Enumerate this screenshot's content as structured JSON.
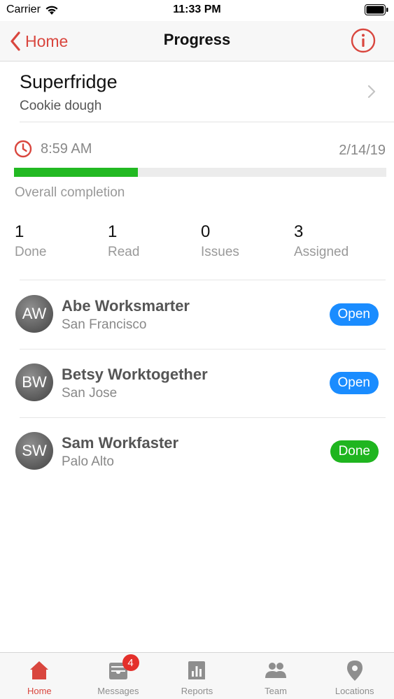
{
  "status_bar": {
    "carrier": "Carrier",
    "time": "11:33 PM"
  },
  "nav": {
    "back_label": "Home",
    "title": "Progress"
  },
  "product": {
    "name": "Superfridge",
    "subtitle": "Cookie dough"
  },
  "progress": {
    "time": "8:59 AM",
    "date": "2/14/19",
    "completion_label": "Overall completion",
    "completion_fraction": 0.333
  },
  "stats": [
    {
      "value": "1",
      "label": "Done"
    },
    {
      "value": "1",
      "label": "Read"
    },
    {
      "value": "0",
      "label": "Issues"
    },
    {
      "value": "3",
      "label": "Assigned"
    }
  ],
  "people": [
    {
      "initials": "AW",
      "name": "Abe Worksmarter",
      "location": "San Francisco",
      "status": "Open",
      "status_color": "#1a8cff"
    },
    {
      "initials": "BW",
      "name": "Betsy Worktogether",
      "location": "San Jose",
      "status": "Open",
      "status_color": "#1a8cff"
    },
    {
      "initials": "SW",
      "name": "Sam Workfaster",
      "location": "Palo Alto",
      "status": "Done",
      "status_color": "#1fb51f"
    }
  ],
  "tabs": [
    {
      "label": "Home",
      "icon": "house-icon",
      "active": true
    },
    {
      "label": "Messages",
      "icon": "inbox-icon",
      "active": false,
      "badge": "4"
    },
    {
      "label": "Reports",
      "icon": "bar-chart-icon",
      "active": false
    },
    {
      "label": "Team",
      "icon": "people-icon",
      "active": false
    },
    {
      "label": "Locations",
      "icon": "map-pin-icon",
      "active": false
    }
  ],
  "colors": {
    "accent": "#d9463e",
    "progress": "#22b922",
    "open": "#1a8cff",
    "done": "#1fb51f",
    "inactive_tab": "#8e8e8e"
  }
}
